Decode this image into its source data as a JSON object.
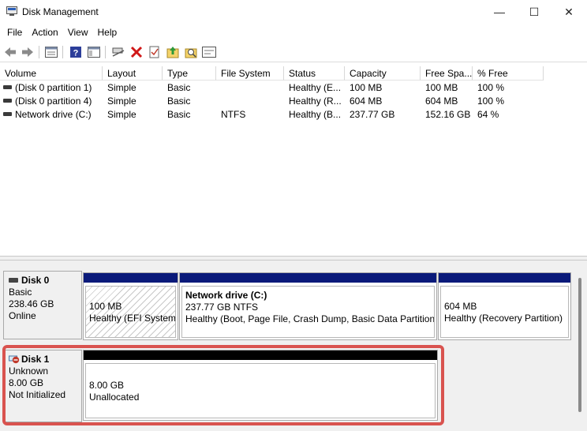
{
  "window": {
    "title": "Disk Management",
    "minimize_glyph": "—",
    "maximize_glyph": "☐",
    "close_glyph": "✕"
  },
  "menu": [
    "File",
    "Action",
    "View",
    "Help"
  ],
  "toolbar": {
    "icons": [
      "back-icon",
      "forward-icon",
      "properties-icon",
      "help-icon",
      "show-hide-icon",
      "connect-icon",
      "delete-icon",
      "check-icon",
      "import-icon",
      "search-icon",
      "console-icon"
    ]
  },
  "volumes": {
    "columns": [
      "Volume",
      "Layout",
      "Type",
      "File System",
      "Status",
      "Capacity",
      "Free Spa...",
      "% Free"
    ],
    "rows": [
      {
        "volume": "(Disk 0 partition 1)",
        "layout": "Simple",
        "type": "Basic",
        "fs": "",
        "status": "Healthy (E...",
        "capacity": "100 MB",
        "free": "100 MB",
        "pct": "100 %"
      },
      {
        "volume": "(Disk 0 partition 4)",
        "layout": "Simple",
        "type": "Basic",
        "fs": "",
        "status": "Healthy (R...",
        "capacity": "604 MB",
        "free": "604 MB",
        "pct": "100 %"
      },
      {
        "volume": "Network drive  (C:)",
        "layout": "Simple",
        "type": "Basic",
        "fs": "NTFS",
        "status": "Healthy (B...",
        "capacity": "237.77 GB",
        "free": "152.16 GB",
        "pct": "64 %"
      }
    ]
  },
  "disks": [
    {
      "name": "Disk 0",
      "type": "Basic",
      "size": "238.46 GB",
      "state": "Online",
      "partitions": [
        {
          "title": "",
          "size": "100 MB",
          "desc": "Healthy (EFI System"
        },
        {
          "title": "Network drive  (C:)",
          "size": "237.77 GB NTFS",
          "desc": "Healthy (Boot, Page File, Crash Dump, Basic Data Partition)"
        },
        {
          "title": "",
          "size": "604 MB",
          "desc": "Healthy (Recovery Partition)"
        }
      ]
    },
    {
      "name": "Disk 1",
      "type": "Unknown",
      "size": "8.00 GB",
      "state": "Not Initialized",
      "partitions": [
        {
          "size": "8.00 GB",
          "desc": "Unallocated"
        }
      ]
    }
  ],
  "colors": {
    "partition_bar": "#0a1a7a",
    "unallocated_bar": "#000000",
    "highlight": "#d9534f"
  }
}
